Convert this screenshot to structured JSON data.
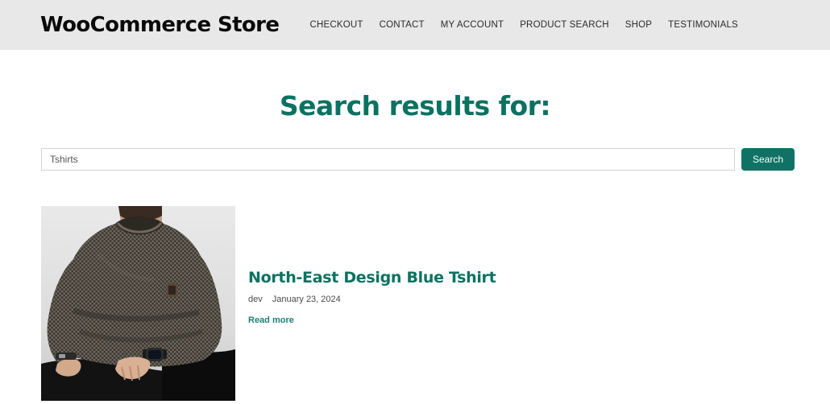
{
  "header": {
    "logo": "WooCommerce Store",
    "nav": [
      {
        "label": "CHECKOUT"
      },
      {
        "label": "CONTACT"
      },
      {
        "label": "MY ACCOUNT"
      },
      {
        "label": "PRODUCT SEARCH"
      },
      {
        "label": "SHOP"
      },
      {
        "label": "TESTIMONIALS"
      }
    ],
    "background_color": "#e8e8e8"
  },
  "main": {
    "page_title": "Search results for:",
    "accent_color": "#0b7261",
    "search": {
      "value": "Tshirts",
      "placeholder": "Search …",
      "submit_label": "Search",
      "button_color": "#0f7264"
    },
    "results": [
      {
        "title": "North-East Design Blue Tshirt",
        "author": "dev",
        "date": "January 23, 2024",
        "read_more_label": "Read more",
        "thumbnail_alt": "man-in-dark-knit-sweater-photo"
      }
    ]
  }
}
